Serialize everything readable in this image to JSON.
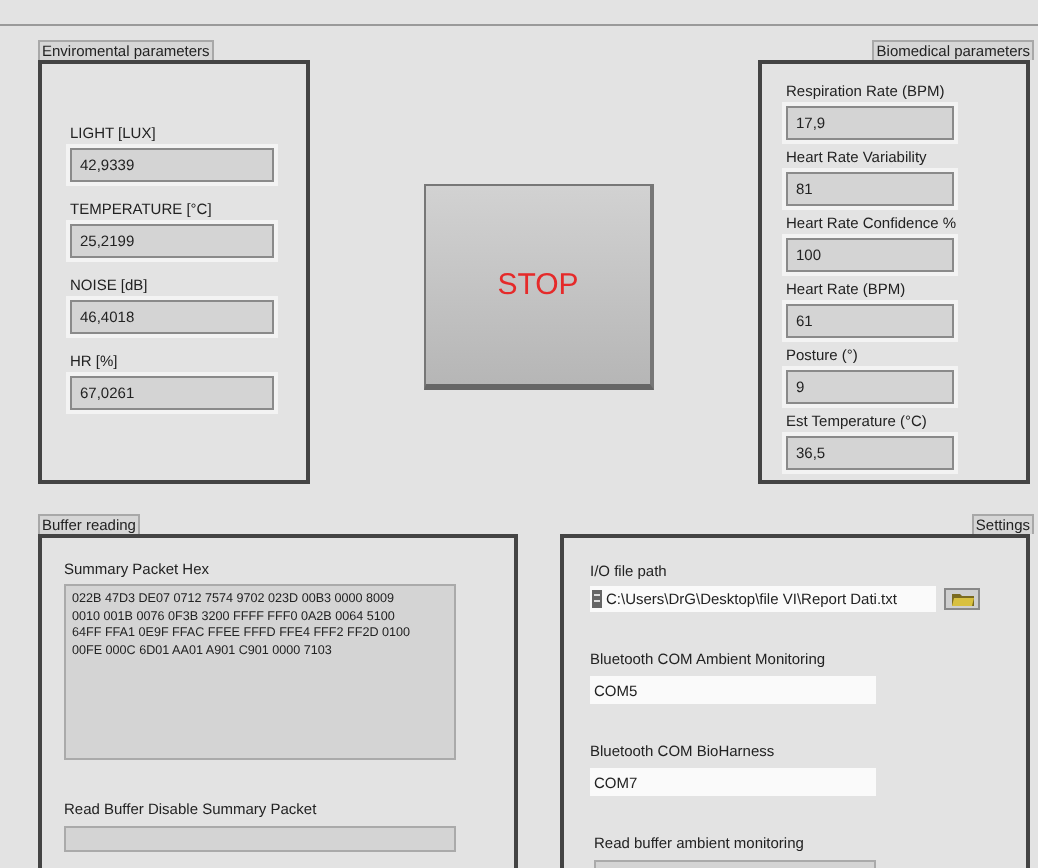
{
  "environmental": {
    "title": "Enviromental parameters",
    "fields": [
      {
        "label": "LIGHT [LUX]",
        "value": "42,9339"
      },
      {
        "label": "TEMPERATURE [°C]",
        "value": "25,2199"
      },
      {
        "label": "NOISE [dB]",
        "value": "46,4018"
      },
      {
        "label": "HR [%]",
        "value": "67,0261"
      }
    ]
  },
  "stop_button": {
    "label": "STOP"
  },
  "biomedical": {
    "title": "Biomedical parameters",
    "fields": [
      {
        "label": "Respiration Rate (BPM)",
        "value": "17,9"
      },
      {
        "label": "Heart Rate Variability",
        "value": "81"
      },
      {
        "label": "Heart Rate Confidence %",
        "value": "100"
      },
      {
        "label": "Heart Rate (BPM)",
        "value": "61"
      },
      {
        "label": "Posture (°)",
        "value": "9"
      },
      {
        "label": "Est Temperature (°C)",
        "value": "36,5"
      }
    ]
  },
  "buffer_reading": {
    "title": "Buffer reading",
    "summary_label": "Summary Packet Hex",
    "summary_value": "022B 47D3 DE07 0712 7574 9702 023D 00B3 0000 8009\n0010 001B 0076 0F3B 3200 FFFF FFF0 0A2B 0064 5100\n64FF FFA1 0E9F FFAC FFEE FFFD FFE4 FFF2 FF2D 0100\n00FE 000C 6D01 AA01 A901 C901 0000 7103",
    "read_label": "Read Buffer Disable Summary Packet"
  },
  "settings": {
    "title": "Settings",
    "file_path": {
      "label": "I/O file path",
      "value": "C:\\Users\\DrG\\Desktop\\file VI\\Report Dati.txt"
    },
    "com_fields": [
      {
        "label": "Bluetooth COM Ambient Monitoring",
        "value": "COM5"
      },
      {
        "label": "Bluetooth COM BioHarness",
        "value": "COM7"
      }
    ],
    "read_label": "Read buffer ambient monitoring"
  }
}
